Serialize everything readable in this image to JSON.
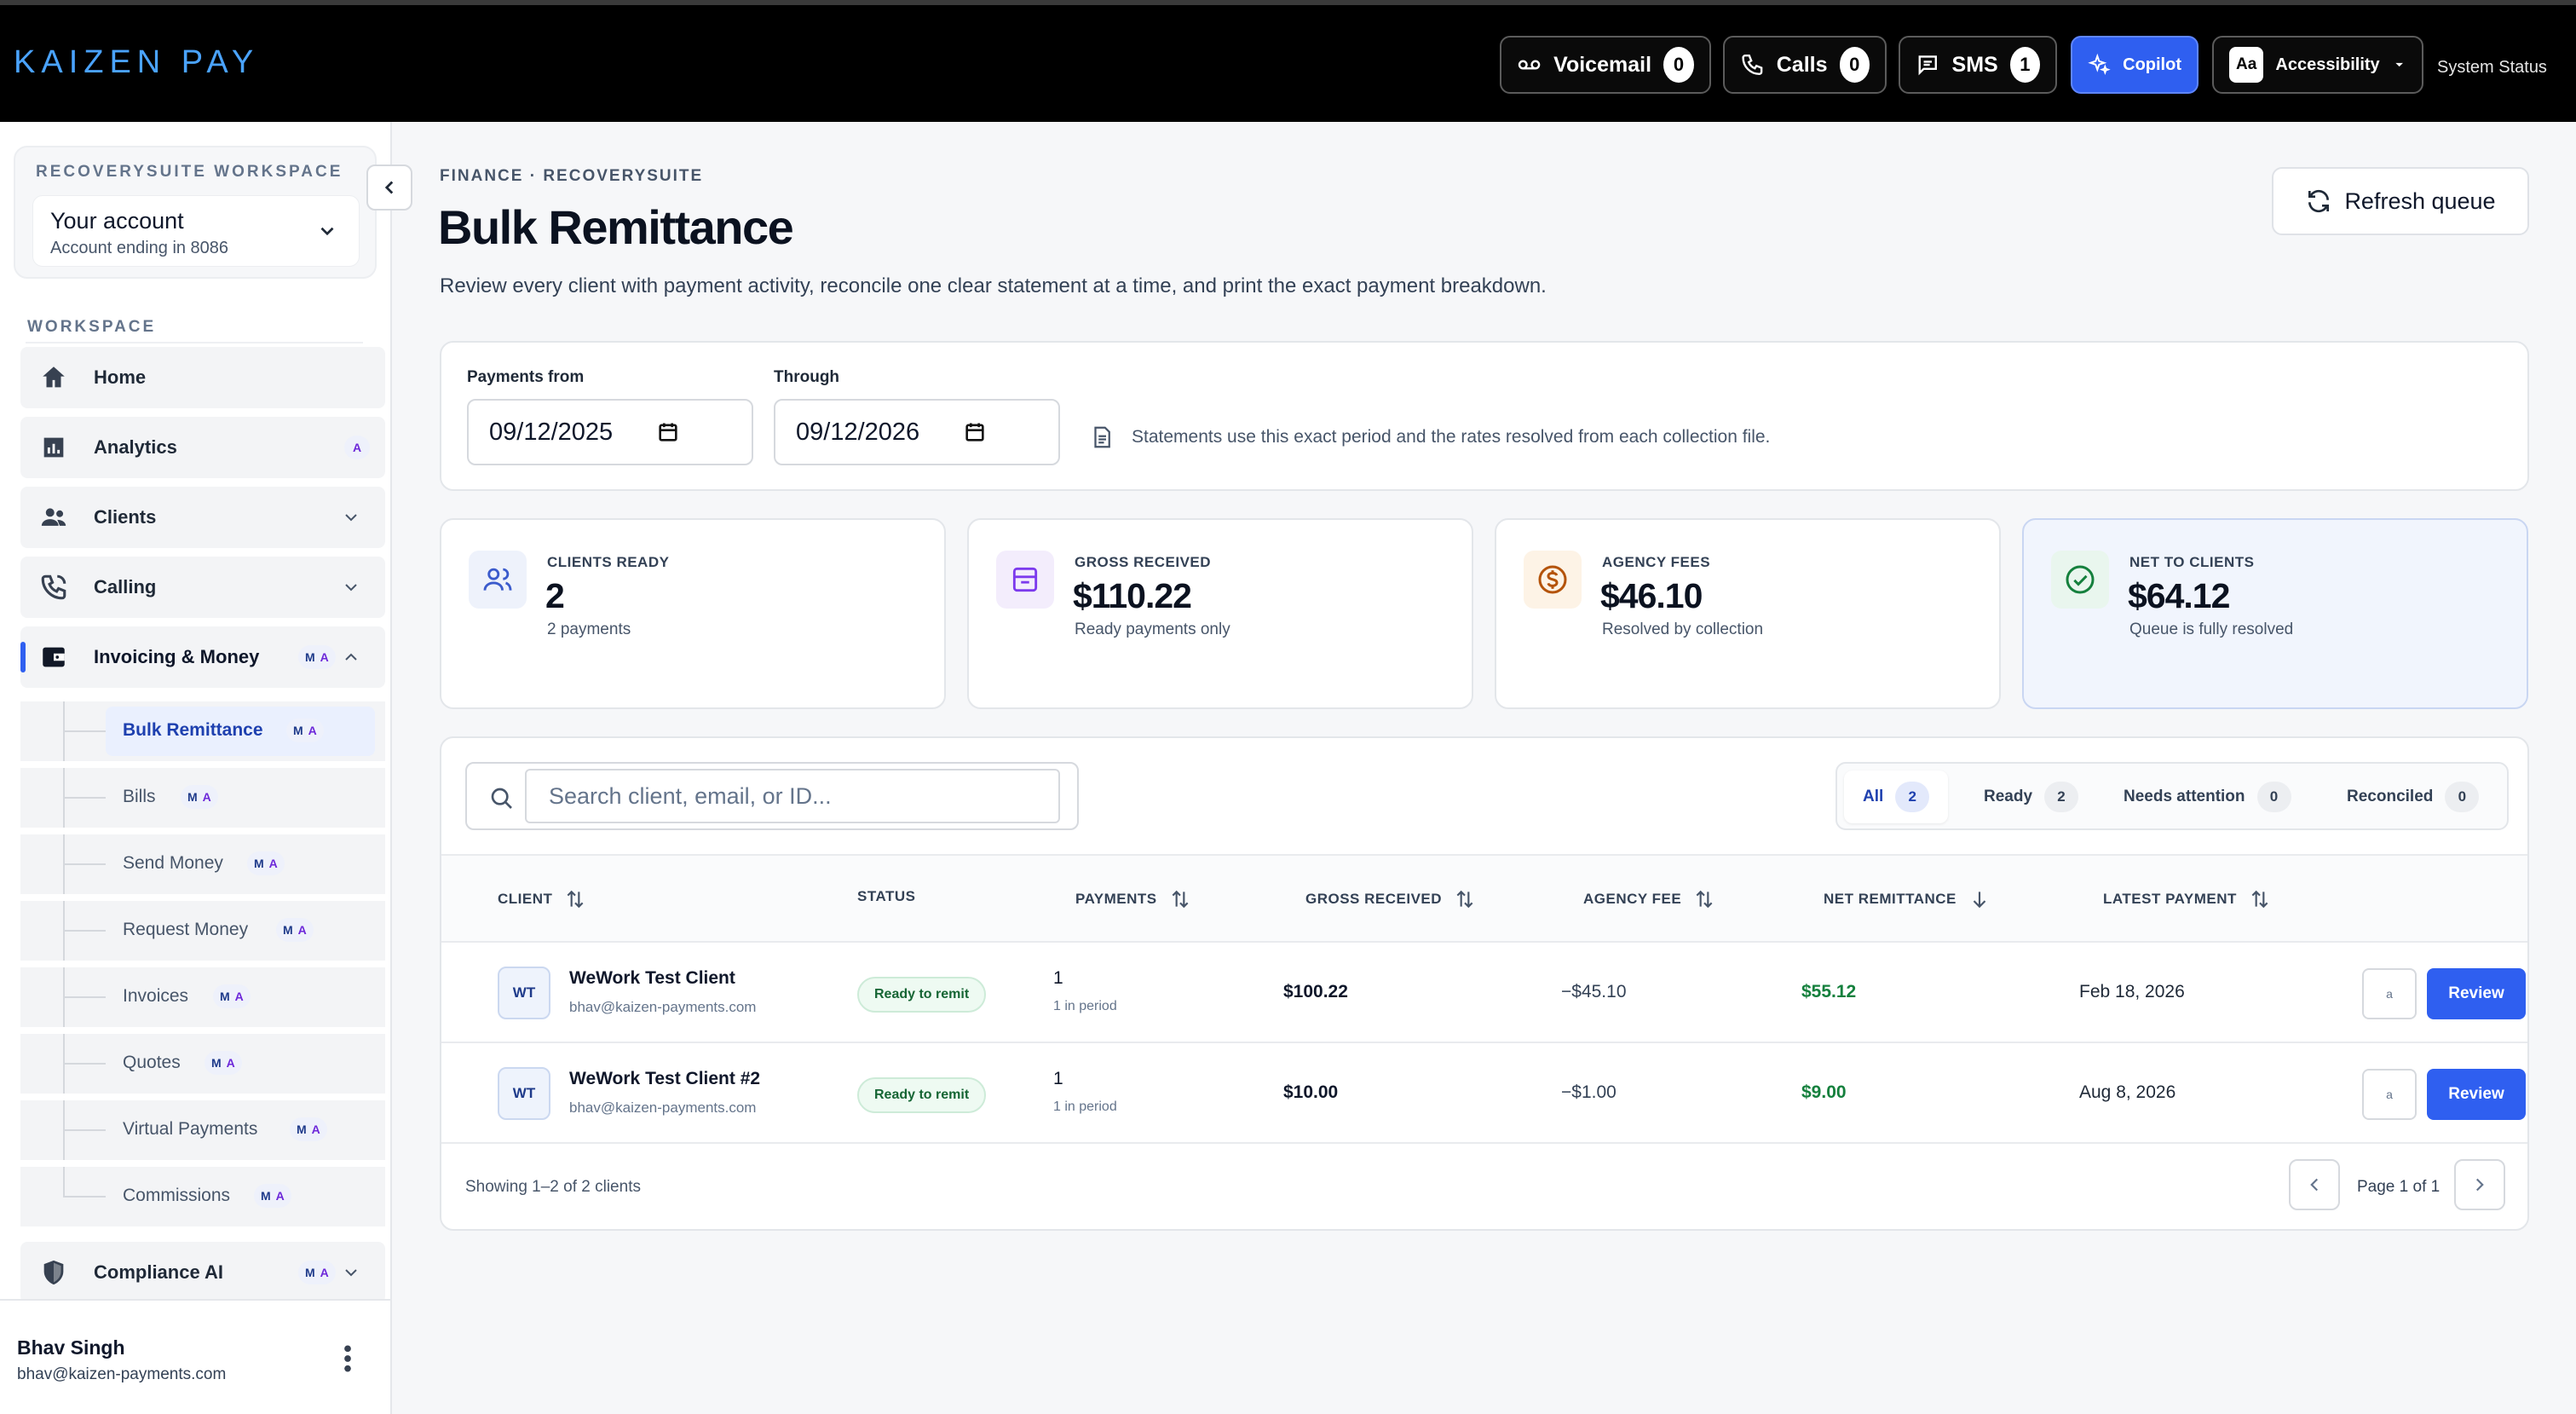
{
  "app": {
    "logo": "KAIZEN PAY",
    "system_status": "System Status"
  },
  "topbar": {
    "voicemail": {
      "label": "Voicemail",
      "count": "0"
    },
    "calls": {
      "label": "Calls",
      "count": "0"
    },
    "sms": {
      "label": "SMS",
      "count": "1"
    },
    "copilot": {
      "label": "Copilot"
    },
    "accessibility": {
      "label": "Accessibility",
      "glyph": "Aa"
    }
  },
  "sidebar": {
    "workspace_label": "RECOVERYSUITE WORKSPACE",
    "account_name": "Your account",
    "account_sub": "Account ending in 8086",
    "section_label": "WORKSPACE",
    "items": [
      {
        "label": "Home",
        "icon": "home-icon"
      },
      {
        "label": "Analytics",
        "icon": "analytics-icon",
        "badge": "A"
      },
      {
        "label": "Clients",
        "icon": "people-icon"
      },
      {
        "label": "Calling",
        "icon": "phone-icon"
      },
      {
        "label": "Invoicing & Money",
        "icon": "wallet-icon",
        "badge_m": "M",
        "badge_a": "A"
      }
    ],
    "subitems": [
      {
        "label": "Bulk Remittance",
        "active": true
      },
      {
        "label": "Bills"
      },
      {
        "label": "Send Money"
      },
      {
        "label": "Request Money"
      },
      {
        "label": "Invoices"
      },
      {
        "label": "Quotes"
      },
      {
        "label": "Virtual Payments"
      },
      {
        "label": "Commissions"
      }
    ],
    "compliance": {
      "label": "Compliance AI",
      "icon": "shield-icon"
    },
    "badge_m": "M",
    "badge_a": "A",
    "user": {
      "name": "Bhav Singh",
      "email": "bhav@kaizen-payments.com"
    }
  },
  "main": {
    "breadcrumb": "FINANCE · RECOVERYSUITE",
    "title": "Bulk Remittance",
    "description": "Review every client with payment activity, reconcile one clear statement at a time, and print the exact payment breakdown.",
    "refresh_label": "Refresh queue",
    "filters": {
      "from_label": "Payments from",
      "from_value": "09/12/2025",
      "through_label": "Through",
      "through_value": "09/12/2026",
      "note": "Statements use this exact period and the rates resolved from each collection file."
    },
    "stats": [
      {
        "label": "CLIENTS READY",
        "value": "2",
        "sub": "2 payments"
      },
      {
        "label": "GROSS RECEIVED",
        "value": "$110.22",
        "sub": "Ready payments only"
      },
      {
        "label": "AGENCY FEES",
        "value": "$46.10",
        "sub": "Resolved by collection"
      },
      {
        "label": "NET TO CLIENTS",
        "value": "$64.12",
        "sub": "Queue is fully resolved"
      }
    ],
    "search_placeholder": "Search client, email, or ID...",
    "tabs": [
      {
        "label": "All",
        "count": "2"
      },
      {
        "label": "Ready",
        "count": "2"
      },
      {
        "label": "Needs attention",
        "count": "0"
      },
      {
        "label": "Reconciled",
        "count": "0"
      }
    ],
    "columns": [
      "CLIENT",
      "STATUS",
      "PAYMENTS",
      "GROSS RECEIVED",
      "AGENCY FEE",
      "NET REMITTANCE",
      "LATEST PAYMENT"
    ],
    "rows": [
      {
        "initials": "WT",
        "name": "WeWork Test Client",
        "email": "bhav@kaizen-payments.com",
        "status": "Ready to remit",
        "payments": "1",
        "payments_sub": "1 in period",
        "gross": "$100.22",
        "fee": "−$45.10",
        "net": "$55.12",
        "latest": "Feb 18, 2026",
        "small_action": "a",
        "action": "Review"
      },
      {
        "initials": "WT",
        "name": "WeWork Test Client #2",
        "email": "bhav@kaizen-payments.com",
        "status": "Ready to remit",
        "payments": "1",
        "payments_sub": "1 in period",
        "gross": "$10.00",
        "fee": "−$1.00",
        "net": "$9.00",
        "latest": "Aug 8, 2026",
        "small_action": "a",
        "action": "Review"
      }
    ],
    "showing": "Showing 1–2 of 2 clients",
    "page": "Page 1 of 1"
  },
  "colors": {
    "accent": "#2f5ff0",
    "logo": "#4aa3ff",
    "positive": "#15803d"
  }
}
